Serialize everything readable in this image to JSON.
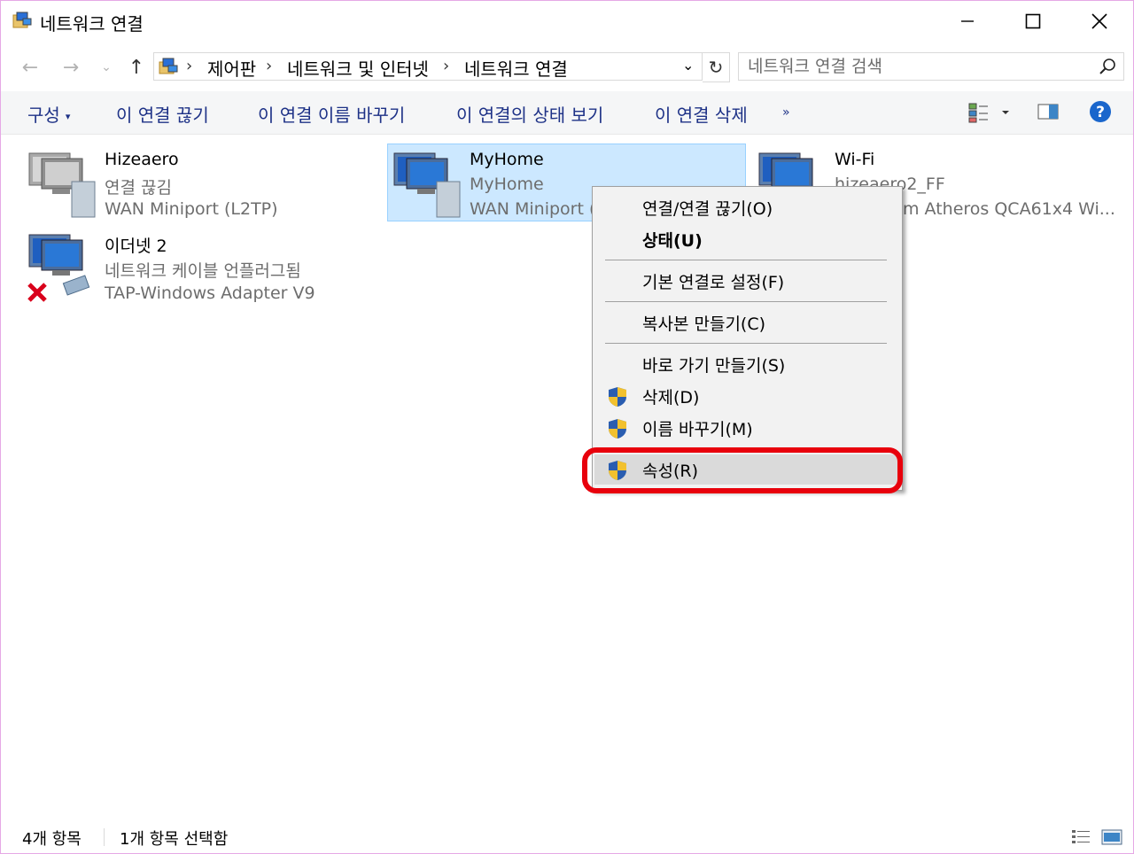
{
  "window": {
    "title": "네트워크 연결"
  },
  "address": {
    "crumbs": [
      "제어판",
      "네트워크 및 인터넷",
      "네트워크 연결"
    ],
    "search_placeholder": "네트워크 연결 검색"
  },
  "toolbar": {
    "organize": "구성",
    "disconnect": "이 연결 끊기",
    "rename": "이 연결 이름 바꾸기",
    "view_status": "이 연결의 상태 보기",
    "delete": "이 연결 삭제",
    "more": "»"
  },
  "connections": [
    {
      "name": "Hizeaero",
      "status": "연결 끊김",
      "device": "WAN Miniport (L2TP)"
    },
    {
      "name": "MyHome",
      "status": "MyHome",
      "device": "WAN Miniport ("
    },
    {
      "name": "Wi-Fi",
      "status": "hizeaero2_FF",
      "device": "m Atheros QCA61x4 Wi..."
    },
    {
      "name": "이더넷 2",
      "status": "네트워크 케이블 언플러그됨",
      "device": "TAP-Windows Adapter V9"
    }
  ],
  "context_menu": {
    "items": [
      "연결/연결 끊기(O)",
      "상태(U)",
      "기본 연결로 설정(F)",
      "복사본 만들기(C)",
      "바로 가기 만들기(S)",
      "삭제(D)",
      "이름 바꾸기(M)",
      "속성(R)"
    ],
    "highlighted": "속성(R)"
  },
  "statusbar": {
    "count": "4개 항목",
    "selected": "1개 항목 선택함"
  },
  "colors": {
    "selection": "#cce8ff",
    "highlight_ring": "#e8000c",
    "command_text": "#1e3287"
  }
}
